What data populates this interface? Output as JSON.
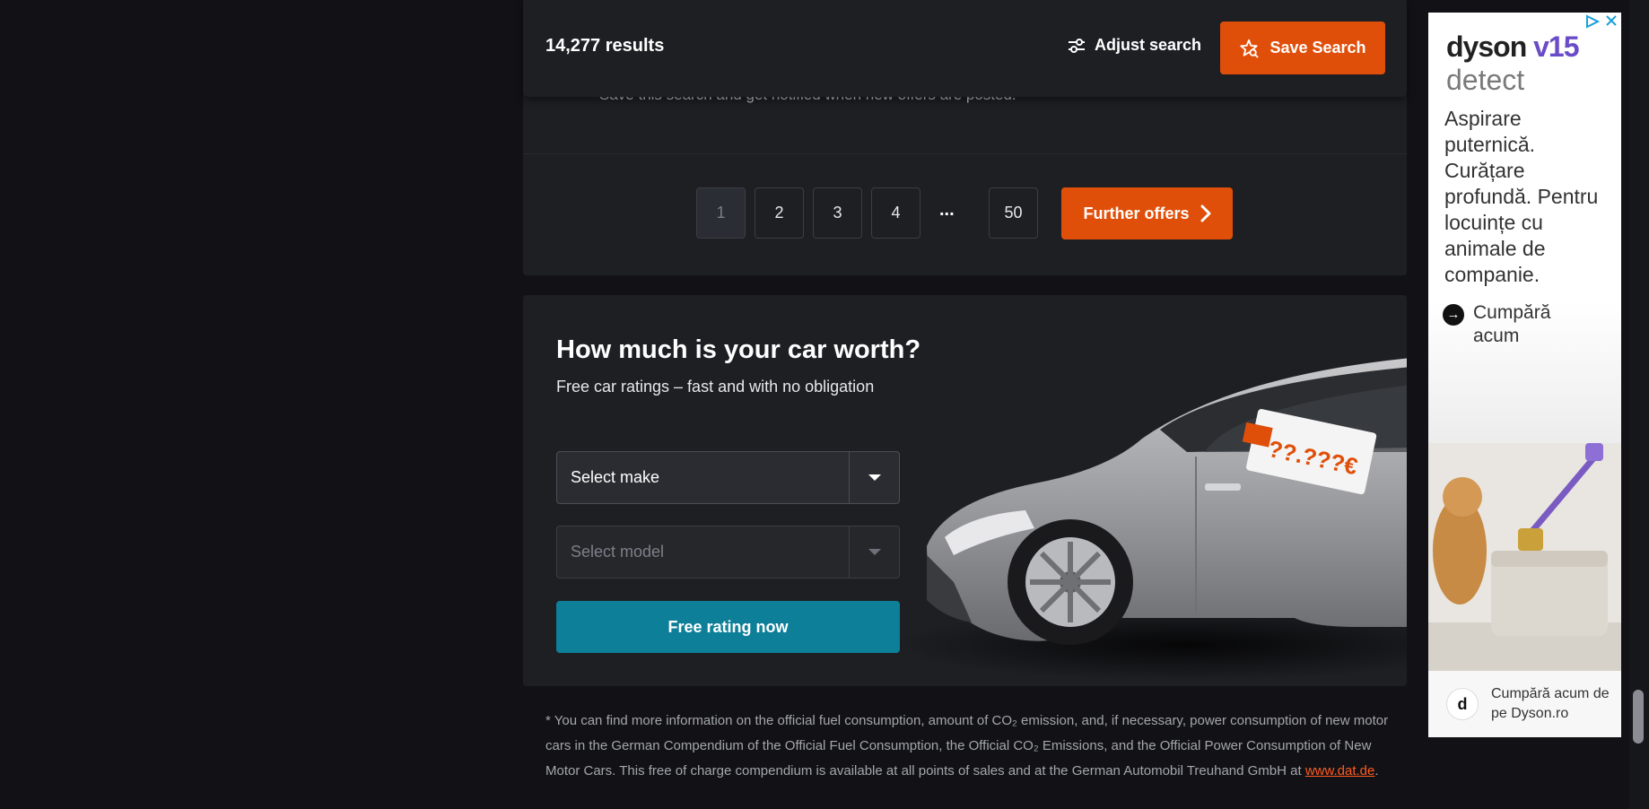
{
  "results": {
    "count": "14,277 results",
    "adjust_label": "Adjust search",
    "save_label": "Save Search",
    "save_hint": "Save this search and get notified when new offers are posted."
  },
  "pagination": {
    "pages": [
      "1",
      "2",
      "3",
      "4"
    ],
    "ellipsis": "...",
    "last": "50",
    "further_label": "Further offers",
    "current": "1"
  },
  "valuation": {
    "title": "How much is your car worth?",
    "subtitle": "Free car ratings – fast and with no obligation",
    "make_placeholder": "Select make",
    "model_placeholder": "Select model",
    "button_label": "Free rating now",
    "price_tag": "??.???€"
  },
  "footnote": {
    "text": "* You can find more information on the official fuel consumption, amount of CO₂ emission, and, if necessary, power consumption of new motor cars in the German Compendium of the Official Fuel Consumption, the Official CO₂ Emissions, and the Official Power Consumption of New Motor Cars. This free of charge compendium is available at all points of sales and at the German Automobil Treuhand GmbH at ",
    "link": "www.dat.de",
    "end": "."
  },
  "ad": {
    "brand": "dyson",
    "model": "v15",
    "detect": "detect",
    "copy": "Aspirare puternică. Curățare profundă. Pentru locuințe cu animale de companie.",
    "cta": "Cumpără acum",
    "bottom": "Cumpără acum de pe Dyson.ro",
    "logo_letter": "d"
  },
  "colors": {
    "accent_orange": "#e04f0a",
    "teal": "#0e7f99",
    "bg": "#121216",
    "card": "#1e1f23"
  },
  "icons": [
    "sliders-icon",
    "star-search-icon",
    "chevron-right-icon",
    "chevron-down-icon",
    "arrow-right-icon",
    "ad-choices-icon"
  ]
}
